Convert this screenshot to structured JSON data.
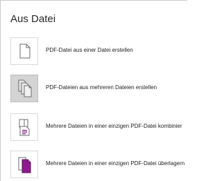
{
  "header": {
    "title": "Aus Datei"
  },
  "items": [
    {
      "label": "PDF-Datei aus einer Datei erstellen",
      "icon": "blank-page-icon",
      "selected": false
    },
    {
      "label": "PDF-Dateien aus mehreren Dateien erstellen",
      "icon": "multiple-pages-icon",
      "selected": true
    },
    {
      "label": "Mehrere Dateien in einer einzigen PDF-Datei kombinier",
      "icon": "combine-pages-icon",
      "selected": false
    },
    {
      "label": "Mehrere Dateien in einer einzigen PDF-Datei überlagern",
      "icon": "overlay-pages-icon",
      "selected": false
    }
  ],
  "colors": {
    "accent": "#8e1a8e",
    "selected_bg": "#d4d4d4",
    "tile_border": "#d9d9d9"
  }
}
